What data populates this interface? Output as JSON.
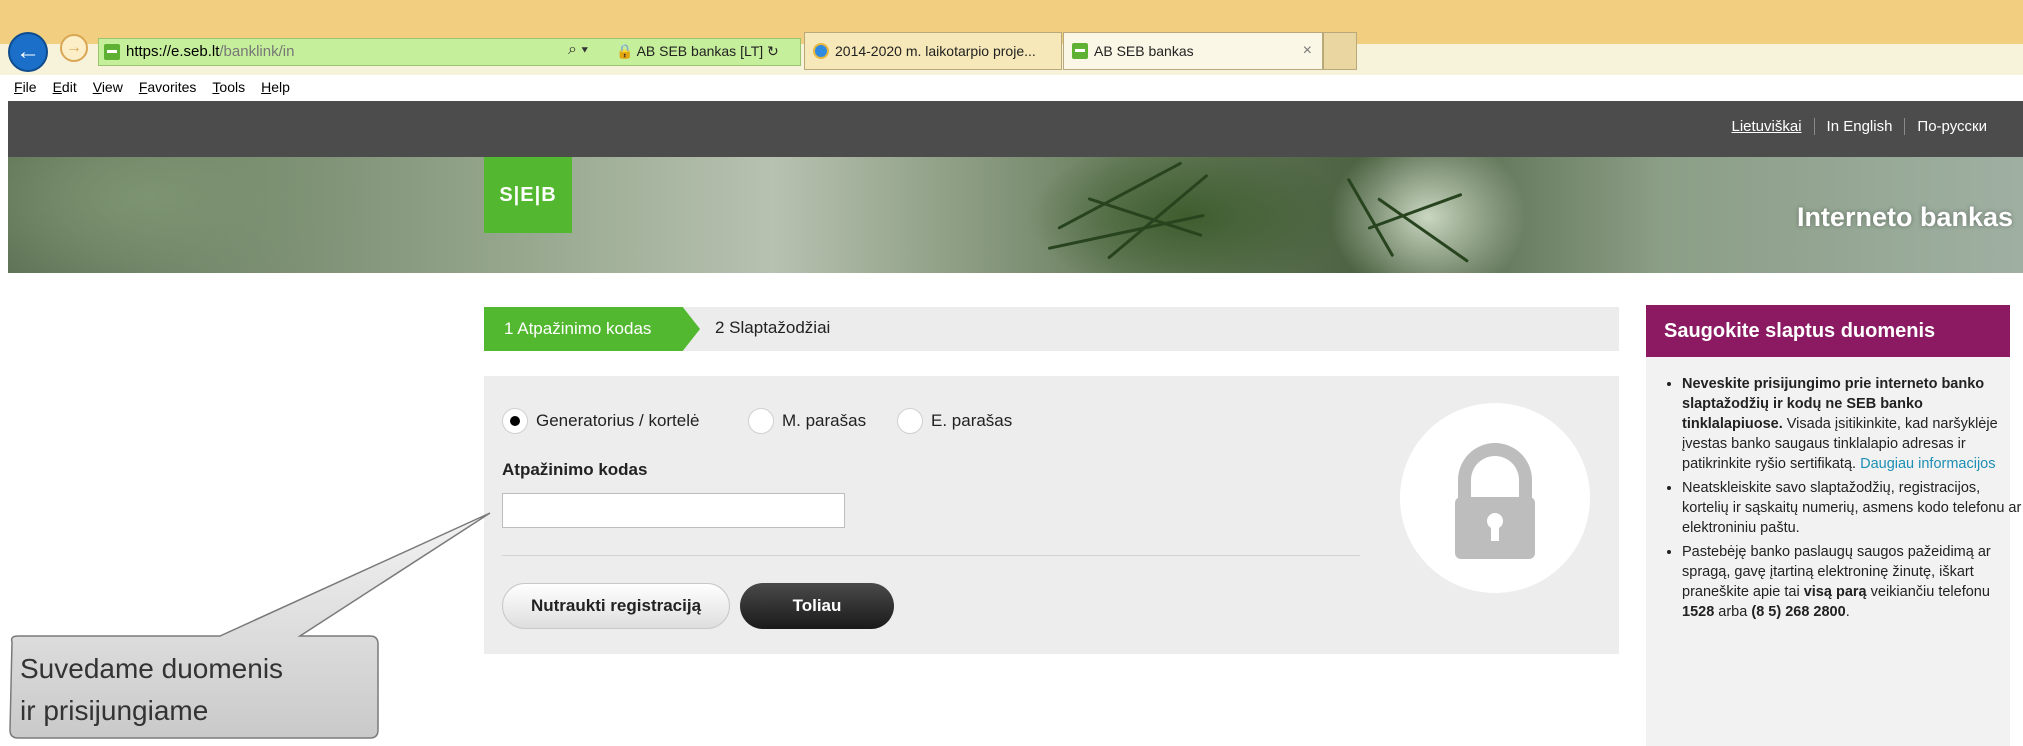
{
  "browser": {
    "url_host": "https://e.seb.lt",
    "url_path": "/banklink/in",
    "address_tools": "⌕ ▾",
    "ssl_label": "AB SEB bankas [LT]",
    "refresh_icon": "↻",
    "tabs": [
      {
        "title": "2014-2020 m. laikotarpio proje..."
      },
      {
        "title": "AB SEB bankas",
        "close": "×"
      }
    ],
    "menu": [
      "File",
      "Edit",
      "View",
      "Favorites",
      "Tools",
      "Help"
    ]
  },
  "header": {
    "languages": [
      "Lietuviškai",
      "In English",
      "По-русски"
    ],
    "logo_text": "S|E|B",
    "banner_title": "Interneto bankas"
  },
  "steps": {
    "step1": "1  Atpažinimo kodas",
    "step2": "2  Slaptažodžiai"
  },
  "form": {
    "methods": [
      "Generatorius / kortelė",
      "M. parašas",
      "E. parašas"
    ],
    "selected_method": "Generatorius / kortelė",
    "code_label": "Atpažinimo kodas",
    "code_value": "",
    "cancel_label": "Nutraukti registraciją",
    "next_label": "Toliau"
  },
  "sidebar": {
    "title": "Saugokite slaptus duomenis",
    "item1_bold": "Neveskite prisijungimo prie interneto banko slaptažodžių ir kodų ne SEB banko tinklalapiuose.",
    "item1_text": " Visada įsitikinkite, kad naršyklėje įvestas banko saugaus tinklalapio adresas ir patikrinkite ryšio sertifikatą. ",
    "item1_link": "Daugiau informacijos",
    "item2_text": "Neatskleiskite savo slaptažodžių, registracijos, kortelių ir sąskaitų numerių, asmens kodo telefonu ar elektroniniu paštu.",
    "item3_text_a": "Pastebėję banko paslaugų saugos pažeidimą ar spragą, gavę įtartiną elektroninę žinutę, iškart praneškite apie tai ",
    "item3_bold_a": "visą parą",
    "item3_text_b": " veikiančiu telefonu ",
    "item3_bold_b": "1528",
    "item3_text_c": " arba ",
    "item3_bold_c": "(8 5) 268 2800",
    "item3_text_d": "."
  },
  "callout": {
    "line1": "Suvedame duomenis",
    "line2": "ir prisijungiame"
  },
  "icons": {
    "back": "arrow-left-icon",
    "forward": "arrow-right-icon",
    "lock": "padlock-icon"
  },
  "colors": {
    "seb_green": "#52b82f",
    "sidebar_head": "#8b1a62",
    "link": "#1d8fb5"
  }
}
